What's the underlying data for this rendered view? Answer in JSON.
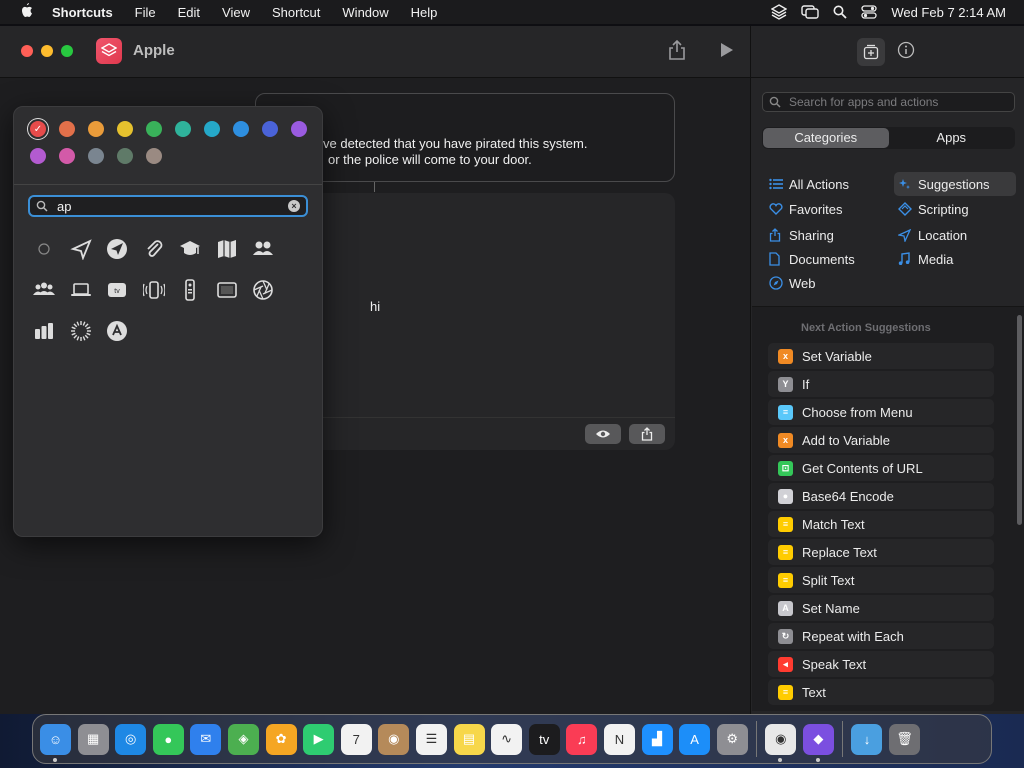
{
  "menubar": {
    "app_name": "Shortcuts",
    "items": [
      "File",
      "Edit",
      "View",
      "Shortcut",
      "Window",
      "Help"
    ],
    "datetime": "Wed Feb 7  2:14 AM"
  },
  "window": {
    "title": "Apple"
  },
  "editor": {
    "card1_line1": "ve detected that you have pirated this system.",
    "card1_line2": "or the police will come to your door.",
    "card2_text": "hi"
  },
  "popover": {
    "colors": [
      "#e64b4b",
      "#e2704a",
      "#e99b3a",
      "#e5c12e",
      "#39b25a",
      "#2fb39b",
      "#25a8c8",
      "#2e8fe0",
      "#4a63d8",
      "#9a5be0",
      "#b35bd0",
      "#d35aa8",
      "#7a8590",
      "#5f7a68",
      "#9a8a82"
    ],
    "search_value": "ap",
    "glyphs": [
      "circle-outline-icon",
      "paper-plane-icon",
      "send-circle-icon",
      "paperclip-icon",
      "graduation-cap-icon",
      "map-icon",
      "people-icon",
      "group-icon",
      "laptop-icon",
      "apple-tv-icon",
      "vibrating-phone-icon",
      "remote-icon",
      "display-icon",
      "aperture-icon",
      "bar-chart-icon",
      "radial-dots-icon",
      "app-store-circle-icon"
    ]
  },
  "sidebar": {
    "search_placeholder": "Search for apps and actions",
    "tabs": [
      "Categories",
      "Apps"
    ],
    "categories_left": [
      "All Actions",
      "Favorites",
      "Sharing",
      "Documents",
      "Web"
    ],
    "categories_right": [
      "Suggestions",
      "Scripting",
      "Location",
      "Media"
    ],
    "suggestions_header": "Next Action Suggestions",
    "actions": [
      {
        "label": "Set Variable",
        "color": "#f08a24",
        "glyph": "x"
      },
      {
        "label": "If",
        "color": "#8e8e93",
        "glyph": "Y"
      },
      {
        "label": "Choose from Menu",
        "color": "#5ac8fa",
        "glyph": "≡"
      },
      {
        "label": "Add to Variable",
        "color": "#f08a24",
        "glyph": "x"
      },
      {
        "label": "Get Contents of URL",
        "color": "#34c759",
        "glyph": "⊡"
      },
      {
        "label": "Base64 Encode",
        "color": "#d1d1d6",
        "glyph": "●"
      },
      {
        "label": "Match Text",
        "color": "#ffcc00",
        "glyph": "≡"
      },
      {
        "label": "Replace Text",
        "color": "#ffcc00",
        "glyph": "≡"
      },
      {
        "label": "Split Text",
        "color": "#ffcc00",
        "glyph": "≡"
      },
      {
        "label": "Set Name",
        "color": "#c7c7cc",
        "glyph": "A"
      },
      {
        "label": "Repeat with Each",
        "color": "#8e8e93",
        "glyph": "↻"
      },
      {
        "label": "Speak Text",
        "color": "#ff3b30",
        "glyph": "◂"
      },
      {
        "label": "Text",
        "color": "#ffcc00",
        "glyph": "≡"
      }
    ]
  },
  "dock": {
    "apps": [
      {
        "name": "finder-icon",
        "color": "#3a8ee6",
        "glyph": "☺",
        "running": true
      },
      {
        "name": "launchpad-icon",
        "color": "#8e8e93",
        "glyph": "▦",
        "running": false
      },
      {
        "name": "safari-icon",
        "color": "#1e88e5",
        "glyph": "◎",
        "running": false
      },
      {
        "name": "messages-icon",
        "color": "#34c759",
        "glyph": "●",
        "running": false
      },
      {
        "name": "mail-icon",
        "color": "#2f80ed",
        "glyph": "✉",
        "running": false
      },
      {
        "name": "maps-icon",
        "color": "#4caf50",
        "glyph": "◈",
        "running": false
      },
      {
        "name": "photos-icon",
        "color": "#f5a623",
        "glyph": "✿",
        "running": false
      },
      {
        "name": "facetime-icon",
        "color": "#2ecc71",
        "glyph": "▶",
        "running": false
      },
      {
        "name": "calendar-icon",
        "color": "#f2f2f2",
        "glyph": "7",
        "running": false
      },
      {
        "name": "contacts-icon",
        "color": "#b58a5a",
        "glyph": "◉",
        "running": false
      },
      {
        "name": "reminders-icon",
        "color": "#f2f2f2",
        "glyph": "☰",
        "running": false
      },
      {
        "name": "notes-icon",
        "color": "#f7d74a",
        "glyph": "▤",
        "running": false
      },
      {
        "name": "freeform-icon",
        "color": "#f2f2f2",
        "glyph": "∿",
        "running": false
      },
      {
        "name": "apple-tv-icon",
        "color": "#1c1c1e",
        "glyph": "tv",
        "running": false
      },
      {
        "name": "music-icon",
        "color": "#fa3c55",
        "glyph": "♫",
        "running": false
      },
      {
        "name": "news-icon",
        "color": "#f2f2f2",
        "glyph": "N",
        "running": false
      },
      {
        "name": "keynote-icon",
        "color": "#1e90ff",
        "glyph": "▟",
        "running": false
      },
      {
        "name": "app-store-icon",
        "color": "#1c8ef9",
        "glyph": "A",
        "running": false
      },
      {
        "name": "system-settings-icon",
        "color": "#8e8e93",
        "glyph": "⚙",
        "running": false
      },
      {
        "name": "chrome-icon",
        "color": "#e8e8e8",
        "glyph": "◉",
        "running": true
      },
      {
        "name": "shortcuts-icon",
        "color": "#7b4fe0",
        "glyph": "◆",
        "running": true
      }
    ],
    "others": [
      {
        "name": "downloads-folder-icon",
        "color": "#4a9fe0",
        "glyph": "↓"
      },
      {
        "name": "trash-icon",
        "color": "#6e6e72",
        "glyph": "🗑"
      }
    ]
  }
}
